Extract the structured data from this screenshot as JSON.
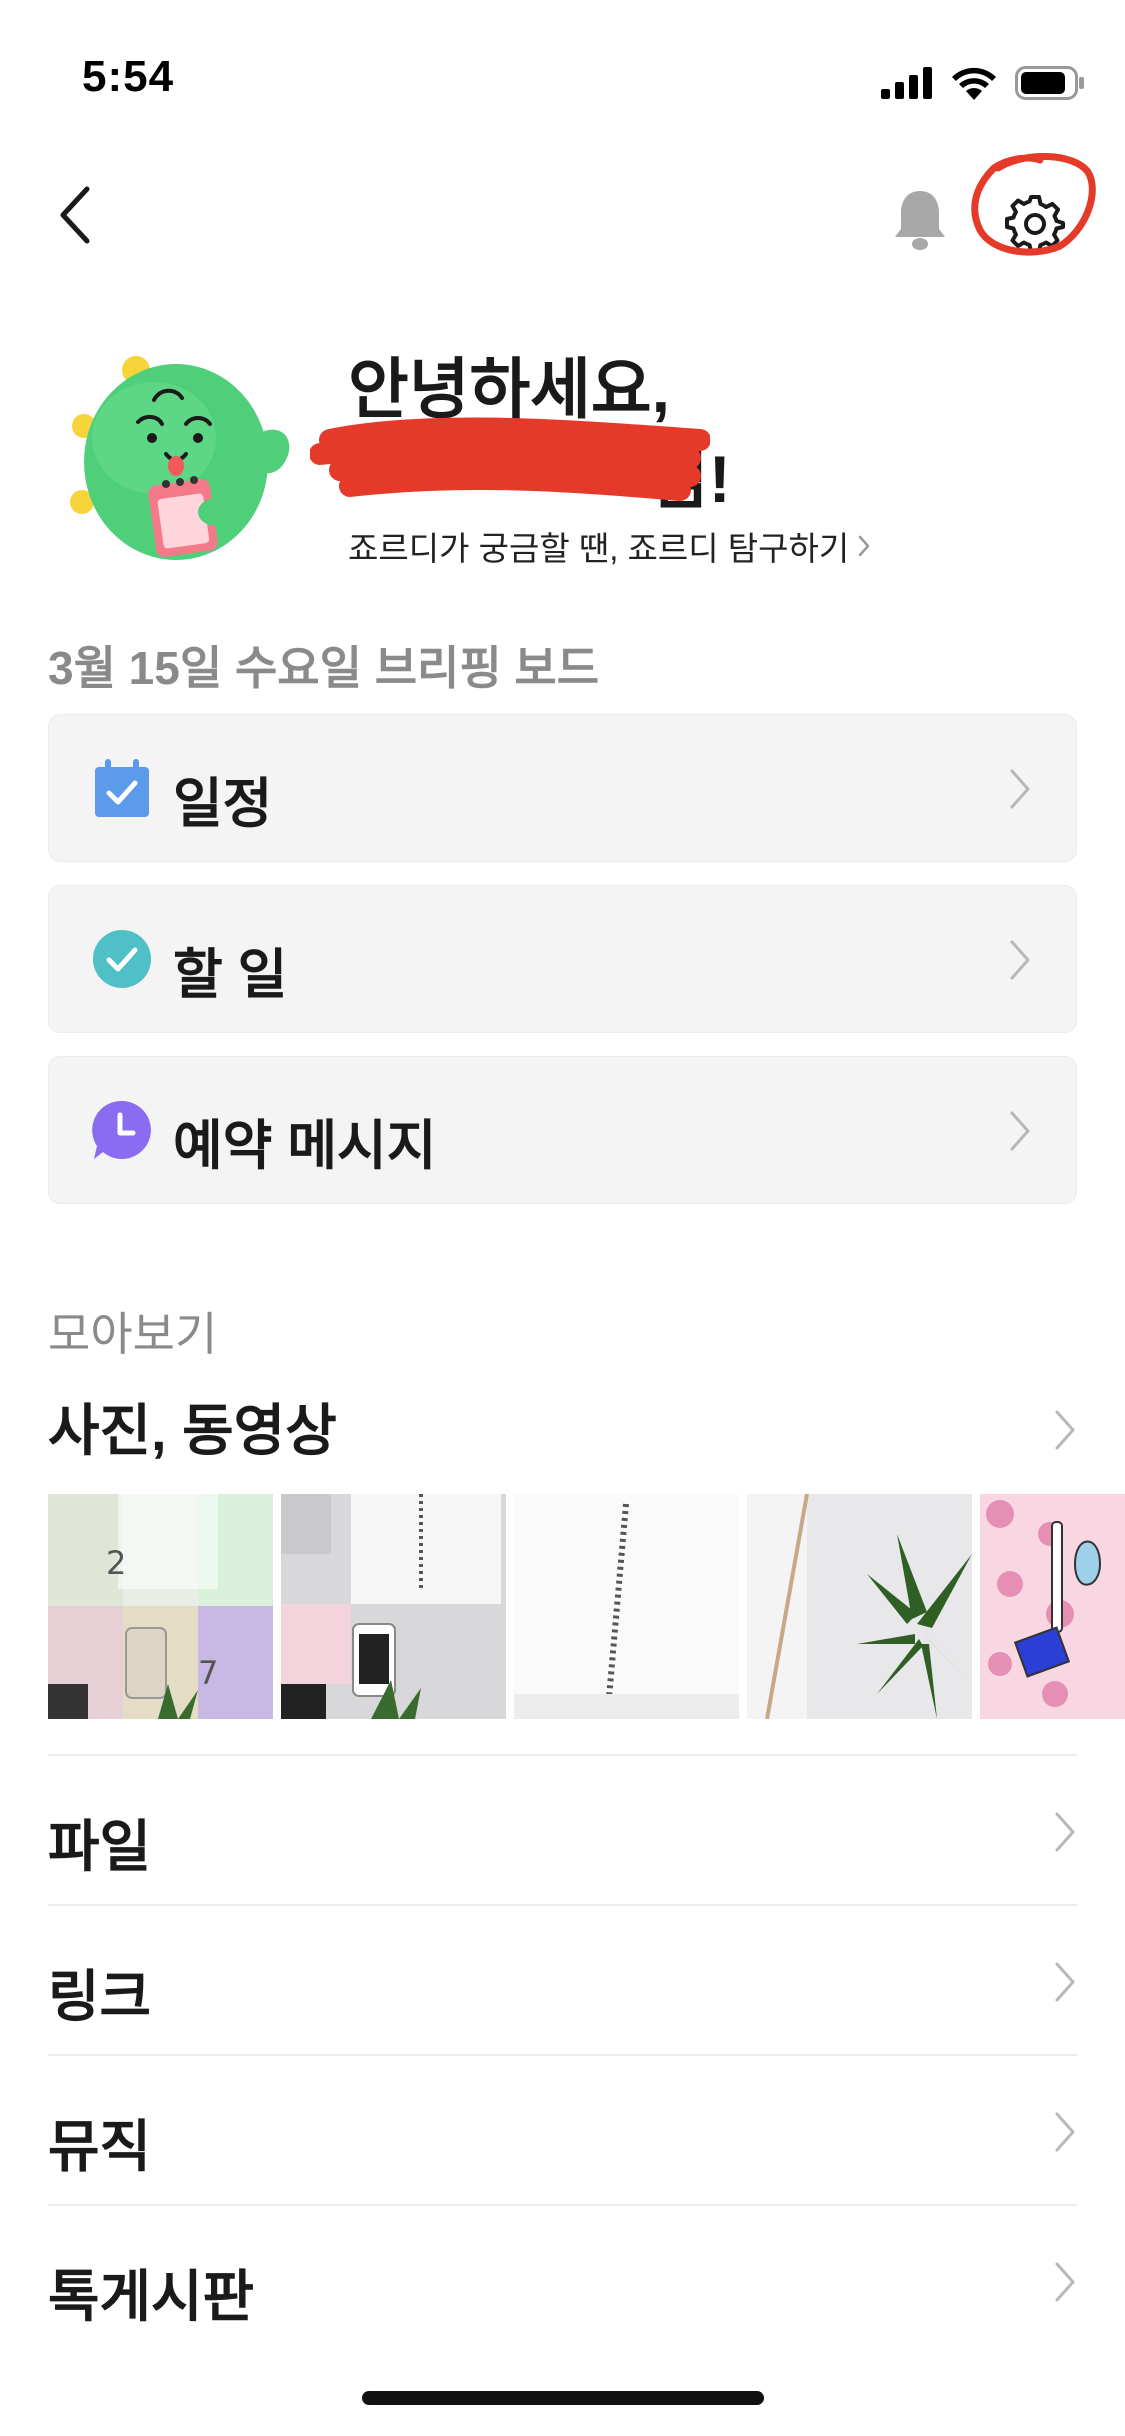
{
  "status_bar": {
    "time": "5:54"
  },
  "greeting": {
    "line1": "안녕하세요,",
    "line2_suffix": "님!",
    "link_text": "죠르디가 궁금할 땐, 죠르디 탐구하기"
  },
  "briefing": {
    "date_title": "3월 15일 수요일 브리핑 보드",
    "items": [
      {
        "label": "일정",
        "icon": "calendar-icon",
        "color": "#5b9bea"
      },
      {
        "label": "할 일",
        "icon": "check-circle-icon",
        "color": "#4fc0c6"
      },
      {
        "label": "예약 메시지",
        "icon": "clock-bubble-icon",
        "color": "#8a6cf0"
      }
    ]
  },
  "collection": {
    "section_title": "모아보기",
    "media_title": "사진, 동영상",
    "list": [
      {
        "label": "파일"
      },
      {
        "label": "링크"
      },
      {
        "label": "뮤직"
      },
      {
        "label": "톡게시판"
      }
    ]
  },
  "colors": {
    "annotation_red": "#e53a2a",
    "card_bg": "#f4f4f4",
    "muted_text": "#8a8a8a"
  }
}
